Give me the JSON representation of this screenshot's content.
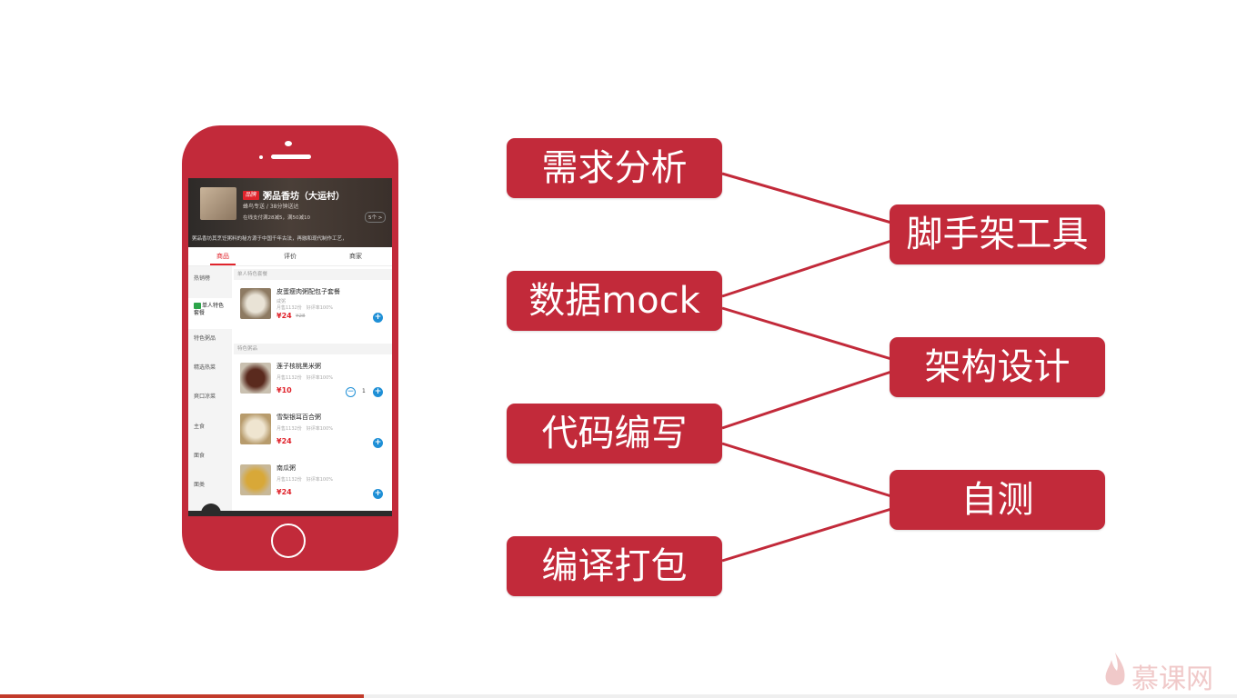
{
  "phone": {
    "shop": {
      "brand_tag": "品牌",
      "name": "粥品香坊（大运村）",
      "delivery": "蜂鸟专送 / 38分钟送达",
      "promo": "在线支付满28减5，满50减10",
      "promo_count": "5个 >",
      "notice": "粥品香坊其烹饪粥料的秘方源于中国千年古法，再融和现代制作工艺，"
    },
    "tabs": [
      "商品",
      "评价",
      "商家"
    ],
    "menu": [
      "热销榜",
      "单人特色套餐",
      "特色粥品",
      "精选热菜",
      "爽口凉菜",
      "主食",
      "面食",
      "面类"
    ],
    "sections": [
      "单人特色套餐",
      "特色粥品"
    ],
    "foods": [
      {
        "name": "皮蛋瘦肉粥配包子套餐",
        "meta": "月售1132份　好评率100%",
        "price": "¥24",
        "old_price": "¥28"
      },
      {
        "name": "莲子核桃黑米粥",
        "meta": "月售1132份　好评率100%",
        "price": "¥10",
        "qty": "1"
      },
      {
        "name": "雪梨银耳百合粥",
        "meta": "月售1132份　好评率100%",
        "price": "¥24"
      },
      {
        "name": "南瓜粥",
        "meta": "月售1132份　好评率100%",
        "price": "¥24"
      }
    ],
    "food1_desc": "咸粥",
    "plus": "+",
    "minus": "−"
  },
  "steps": [
    "需求分析",
    "数据mock",
    "代码编写",
    "编译打包"
  ],
  "outcomes": [
    "脚手架工具",
    "架构设计",
    "自测"
  ],
  "colors": {
    "accent": "#c22a3a"
  },
  "logo": {
    "text": "慕课网"
  }
}
